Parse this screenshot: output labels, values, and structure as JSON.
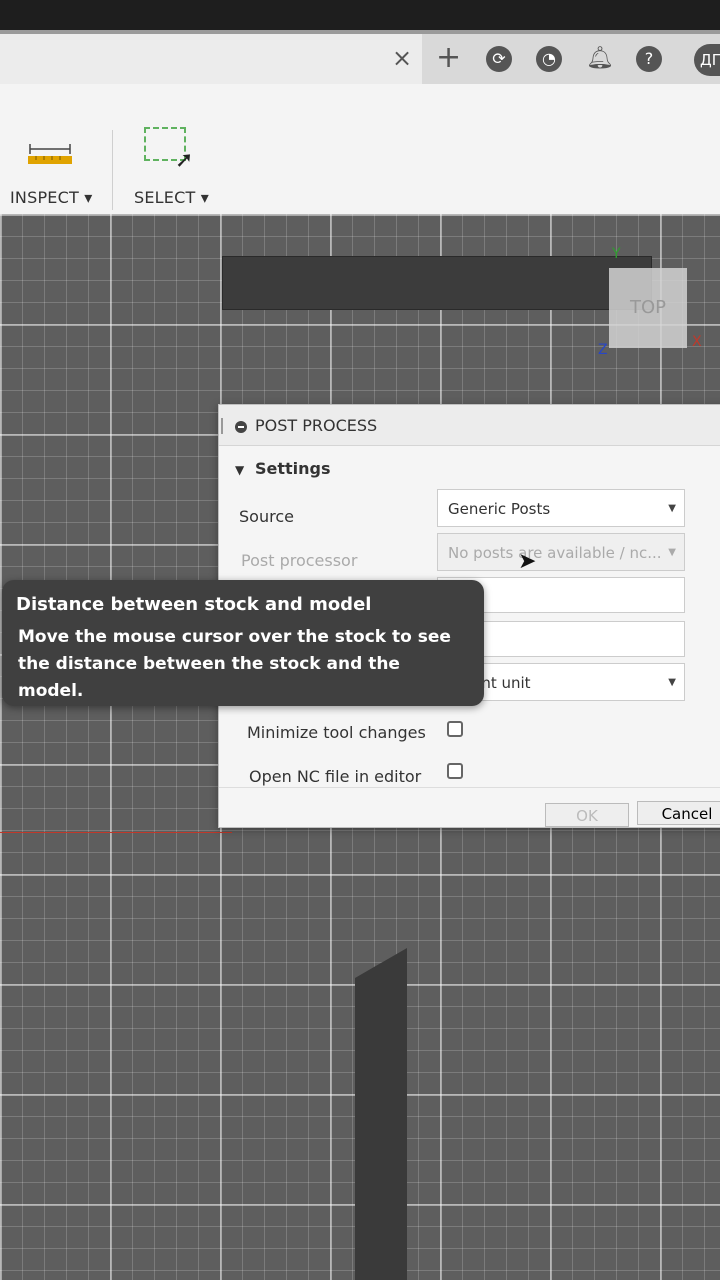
{
  "appbar": {
    "close_glyph": "×",
    "plus_glyph": "+",
    "lang_label": "ДГ",
    "icons": [
      "refresh-icon",
      "clock-icon",
      "bell-icon",
      "help-icon"
    ]
  },
  "toolbar": {
    "inspect_label": "INSPECT ▾",
    "select_label": "SELECT ▾"
  },
  "viewcube": {
    "face_label": "TOP",
    "axis_y": "Y",
    "axis_z": "Z",
    "axis_x": "X"
  },
  "dialog": {
    "title": "POST PROCESS",
    "section": "Settings",
    "source_label": "Source",
    "source_value": "Generic Posts",
    "post_processor_label": "Post processor",
    "post_processor_value": "No posts are available / nc...",
    "output_unit_value": "ument unit",
    "minimize_tool_changes_label": "Minimize tool changes",
    "open_nc_label": "Open NC file in editor",
    "ok_label": "OK",
    "cancel_label": "Cancel"
  },
  "tooltip": {
    "title": "Distance between stock and model",
    "body": "Move the mouse cursor over the stock to see the distance between the stock and the model."
  },
  "colors": {
    "axis_y": "#2e9e2e",
    "axis_z": "#2746c8",
    "axis_x": "#c0392b",
    "tooltip_bg": "#404040"
  }
}
